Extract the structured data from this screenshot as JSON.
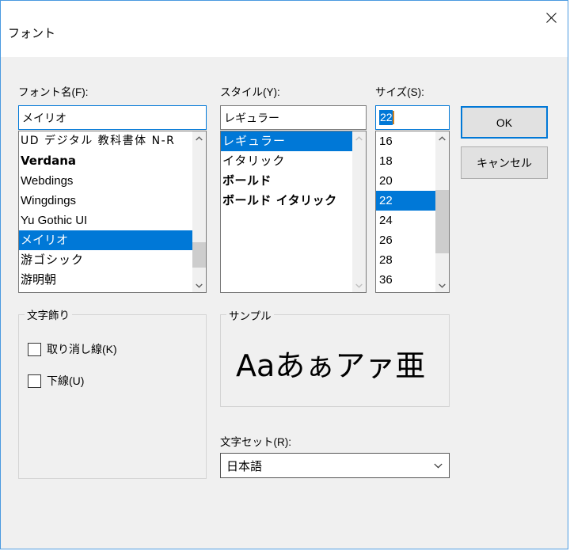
{
  "window": {
    "title": "フォント",
    "close_icon": "close-icon",
    "border_color": "#4a9ae0",
    "body_color": "#f0f0f0",
    "accent_color": "#0078d7"
  },
  "font_name": {
    "label": "フォント名(F):",
    "value": "メイリオ",
    "items": [
      {
        "label": "UD  デジタル  教科書体  N-R",
        "style": "f-ud",
        "selected": false
      },
      {
        "label": "Verdana",
        "style": "f-verdana",
        "selected": false
      },
      {
        "label": "Webdings",
        "style": "f-web",
        "selected": false
      },
      {
        "label": "Wingdings",
        "style": "f-wing",
        "selected": false
      },
      {
        "label": "Yu Gothic UI",
        "style": "f-yu",
        "selected": false
      },
      {
        "label": "メイリオ",
        "style": "f-meiryo",
        "selected": true
      },
      {
        "label": "游ゴシック",
        "style": "f-yugo",
        "selected": false
      },
      {
        "label": "游明朝",
        "style": "f-yumin",
        "selected": false
      }
    ],
    "scrollbar": {
      "up_icon": "chevron-up-icon",
      "down_icon": "chevron-down-icon",
      "enabled": true
    }
  },
  "style": {
    "label": "スタイル(Y):",
    "value": "レギュラー",
    "items": [
      {
        "label": "レギュラー",
        "style": "st-reg",
        "selected": true
      },
      {
        "label": "イタリック",
        "style": "st-ital",
        "selected": false
      },
      {
        "label": "ボールド",
        "style": "st-bold",
        "selected": false
      },
      {
        "label": "ボールド イタリック",
        "style": "st-boldi",
        "selected": false
      }
    ],
    "scrollbar": {
      "up_icon": "chevron-up-icon",
      "down_icon": "chevron-down-icon",
      "enabled": false
    }
  },
  "size": {
    "label": "サイズ(S):",
    "value": "22",
    "value_selected": true,
    "items": [
      {
        "label": "16",
        "selected": false
      },
      {
        "label": "18",
        "selected": false
      },
      {
        "label": "20",
        "selected": false
      },
      {
        "label": "22",
        "selected": true
      },
      {
        "label": "24",
        "selected": false
      },
      {
        "label": "26",
        "selected": false
      },
      {
        "label": "28",
        "selected": false
      },
      {
        "label": "36",
        "selected": false
      }
    ],
    "scrollbar": {
      "up_icon": "chevron-up-icon",
      "down_icon": "chevron-down-icon",
      "enabled": true
    }
  },
  "buttons": {
    "ok": "OK",
    "cancel": "キャンセル"
  },
  "effects": {
    "legend": "文字飾り",
    "strikeout": {
      "label": "取り消し線(K)",
      "checked": false
    },
    "underline": {
      "label": "下線(U)",
      "checked": false
    }
  },
  "sample": {
    "legend": "サンプル",
    "text": "Aaあぁアァ亜"
  },
  "script": {
    "label": "文字セット(R):",
    "value": "日本語",
    "arrow_icon": "chevron-down-icon"
  }
}
